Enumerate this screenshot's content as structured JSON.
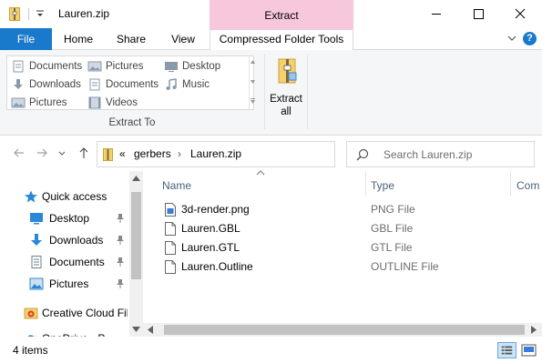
{
  "window": {
    "title": "Lauren.zip",
    "context_tab_group": "Extract",
    "minimize": "minimize",
    "maximize": "maximize",
    "close": "close"
  },
  "tabs": {
    "file": "File",
    "home": "Home",
    "share": "Share",
    "view": "View",
    "compressed_folder_tools": "Compressed Folder Tools",
    "help": "?"
  },
  "ribbon": {
    "extract_to_items": [
      {
        "label": "Documents",
        "icon": "documents-icon"
      },
      {
        "label": "Pictures",
        "icon": "pictures-icon"
      },
      {
        "label": "Desktop",
        "icon": "desktop-icon"
      },
      {
        "label": "Downloads",
        "icon": "downloads-icon"
      },
      {
        "label": "Documents",
        "icon": "documents-icon"
      },
      {
        "label": "Music",
        "icon": "music-icon"
      },
      {
        "label": "Pictures",
        "icon": "pictures-icon"
      },
      {
        "label": "Videos",
        "icon": "videos-icon"
      }
    ],
    "extract_to_label": "Extract To",
    "extract_all_line1": "Extract",
    "extract_all_line2": "all"
  },
  "address": {
    "overflow": "«",
    "crumbs": [
      "gerbers",
      "Lauren.zip"
    ],
    "separator": "›"
  },
  "search": {
    "placeholder": "Search Lauren.zip"
  },
  "nav_pane": {
    "items": [
      {
        "label": "Quick access",
        "icon": "star-icon",
        "pinned": false
      },
      {
        "label": "Desktop",
        "icon": "desktop-icon",
        "pinned": true
      },
      {
        "label": "Downloads",
        "icon": "downloads-icon",
        "pinned": true
      },
      {
        "label": "Documents",
        "icon": "documents-icon",
        "pinned": true
      },
      {
        "label": "Pictures",
        "icon": "pictures-icon",
        "pinned": true
      },
      {
        "label": "Creative Cloud Fil",
        "icon": "creative-cloud-icon",
        "pinned": false
      },
      {
        "label": "OneDrive - P",
        "icon": "onedrive-icon",
        "pinned": false
      }
    ]
  },
  "columns": {
    "name": "Name",
    "type": "Type",
    "compressed": "Com"
  },
  "files": [
    {
      "name": "3d-render.png",
      "type": "PNG File",
      "icon": "image-file-icon"
    },
    {
      "name": "Lauren.GBL",
      "type": "GBL File",
      "icon": "file-icon"
    },
    {
      "name": "Lauren.GTL",
      "type": "GTL File",
      "icon": "file-icon"
    },
    {
      "name": "Lauren.Outline",
      "type": "OUTLINE File",
      "icon": "file-icon"
    }
  ],
  "status": {
    "item_count": "4 items"
  },
  "colors": {
    "file_tab": "#1979ca",
    "context_tab": "#f7c7dc",
    "header_text": "#4c607a"
  }
}
